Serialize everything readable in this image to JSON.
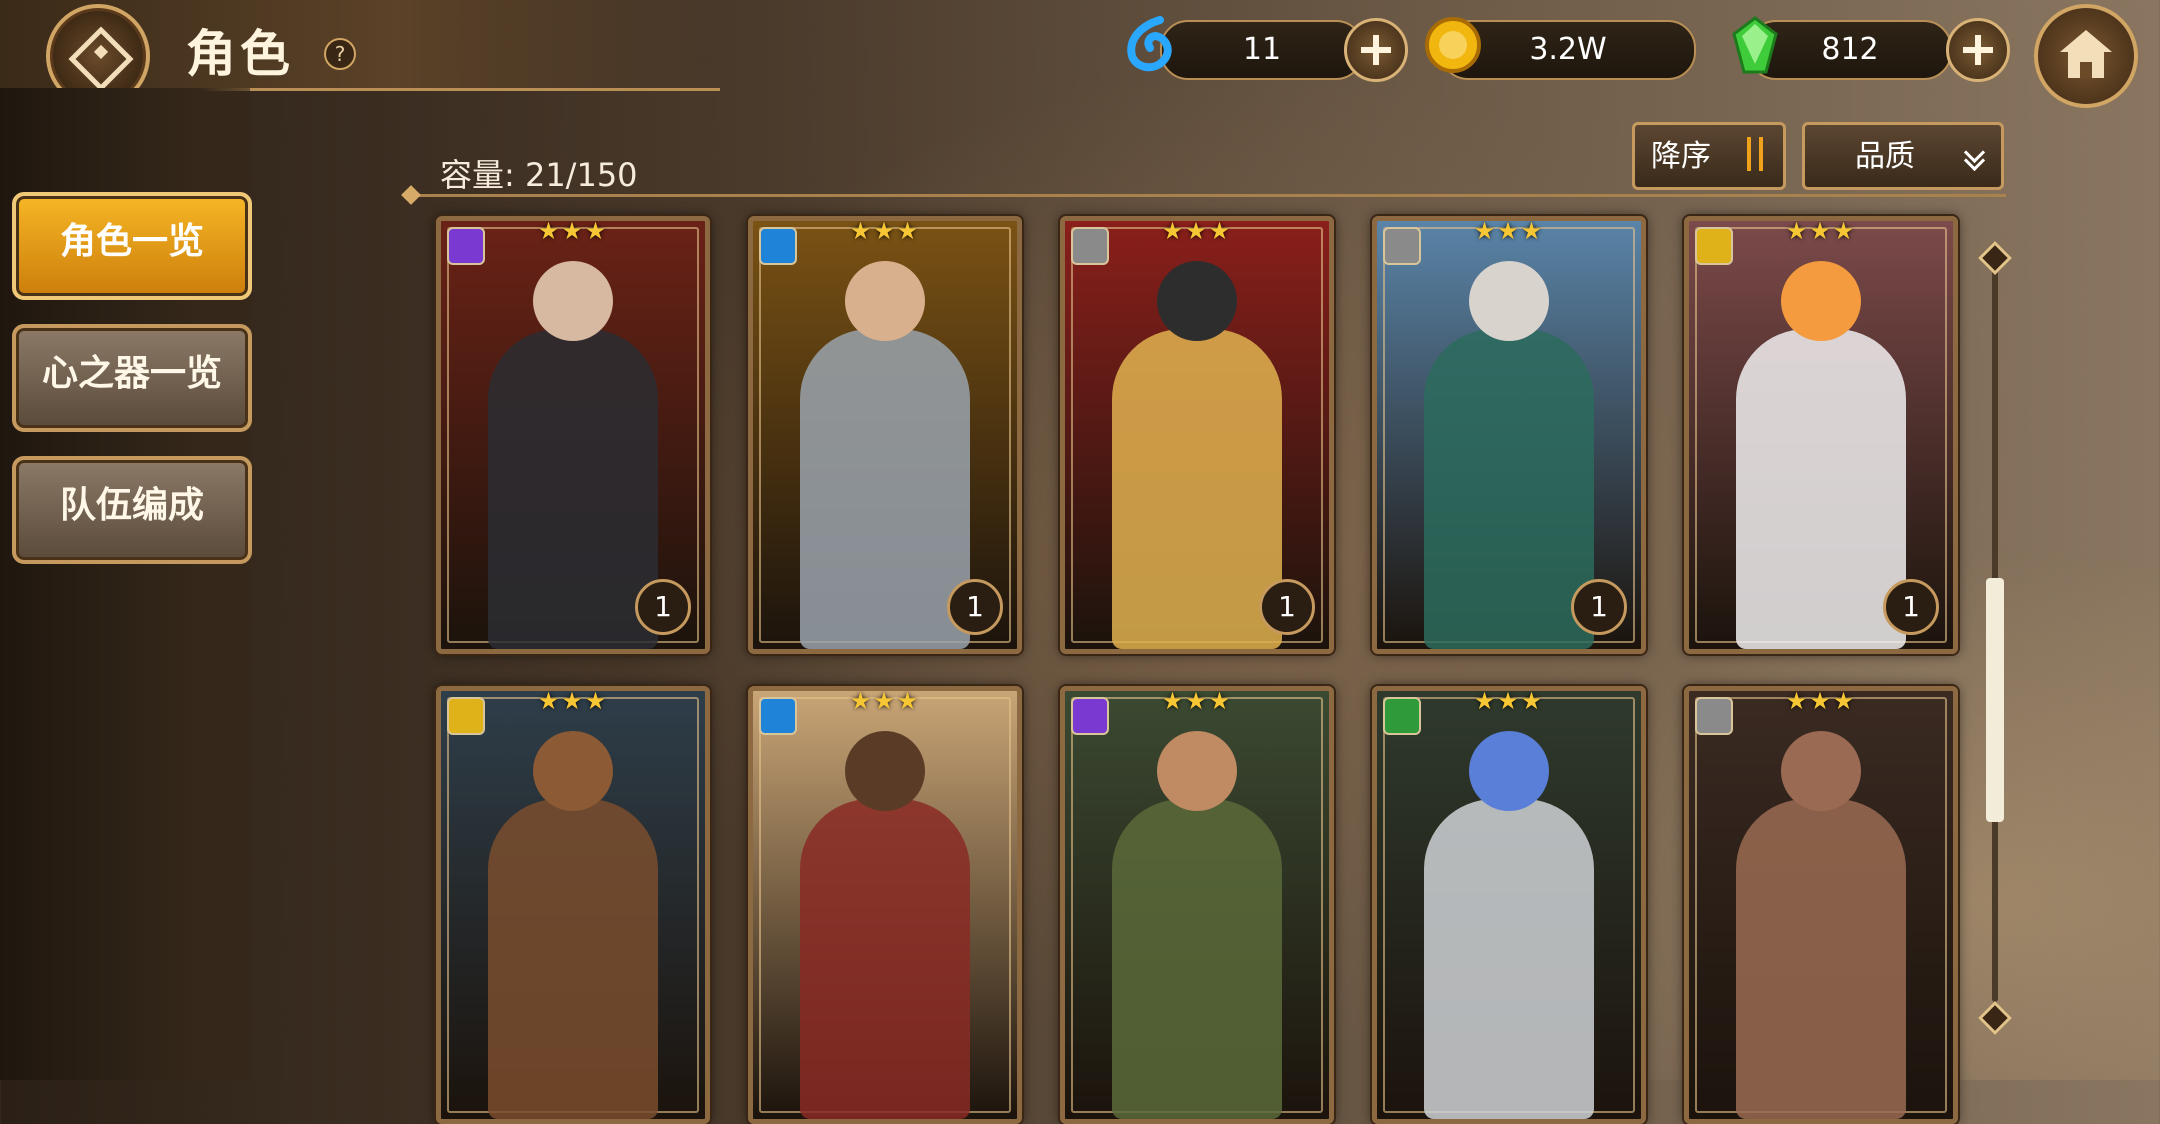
{
  "header": {
    "title": "角色",
    "help_symbol": "?"
  },
  "currencies": [
    {
      "name": "water-drop",
      "value": "11",
      "icon": "blue-water-drop-icon",
      "color": "#2aa7ff"
    },
    {
      "name": "gold-coin",
      "value": "3.2W",
      "icon": "gold-coin-icon",
      "color": "#f2b70f"
    },
    {
      "name": "green-crystal",
      "value": "812",
      "icon": "green-crystal-icon",
      "color": "#3fcc3b"
    }
  ],
  "menu": {
    "items": [
      {
        "label": "角色一览",
        "active": true
      },
      {
        "label": "心之器一览",
        "active": false
      },
      {
        "label": "队伍编成",
        "active": false
      }
    ]
  },
  "capacity": {
    "text": "容量: 21/150"
  },
  "sort": {
    "label": "降序"
  },
  "filter": {
    "label": "品质"
  },
  "cards": [
    {
      "stars": "★★★",
      "level": "1",
      "element": "purple",
      "bg": "#6b2216",
      "figure": "#2b2d33",
      "skin": "#d7b8a0"
    },
    {
      "stars": "★★★",
      "level": "1",
      "element": "blue",
      "bg": "#7a5214",
      "figure": "#9aa3ad",
      "skin": "#d9b08d"
    },
    {
      "stars": "★★★",
      "level": "1",
      "element": "gray",
      "bg": "#8a1f1b",
      "figure": "#e0b24f",
      "skin": "#2d2d2d"
    },
    {
      "stars": "★★★",
      "level": "1",
      "element": "gray",
      "bg": "#5a84a8",
      "figure": "#2b6b5d",
      "skin": "#d8d3cc"
    },
    {
      "stars": "★★★",
      "level": "1",
      "element": "yellow",
      "bg": "#7c4a4a",
      "figure": "#f1eef0",
      "skin": "#f39b3e"
    },
    {
      "stars": "★★★",
      "level": "",
      "element": "yellow",
      "bg": "#2e3e4a",
      "figure": "#7a4e2e",
      "skin": "#8c5a34"
    },
    {
      "stars": "★★★",
      "level": "",
      "element": "blue",
      "bg": "#c9a576",
      "figure": "#8a2a25",
      "skin": "#5a3b25"
    },
    {
      "stars": "★★★",
      "level": "",
      "element": "purple",
      "bg": "#3b4a32",
      "figure": "#5b6a3a",
      "skin": "#c08b63"
    },
    {
      "stars": "★★★",
      "level": "",
      "element": "green",
      "bg": "#2f3a2d",
      "figure": "#cfd2d6",
      "skin": "#5a7fd8"
    },
    {
      "stars": "★★★",
      "level": "",
      "element": "gray",
      "bg": "#3a2a22",
      "figure": "#9a6b52",
      "skin": "#9a6b52"
    }
  ],
  "element_colors": {
    "purple": "#7a3ad1",
    "blue": "#1f84d8",
    "gray": "#8a8a8a",
    "yellow": "#e0b21a",
    "green": "#2f9a3a"
  }
}
